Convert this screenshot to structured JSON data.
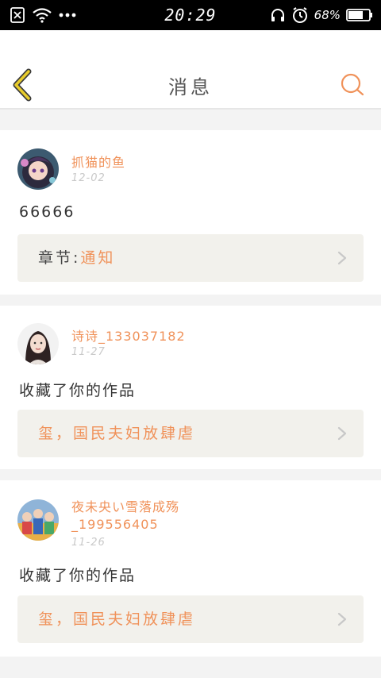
{
  "status_bar": {
    "time": "20:29",
    "battery": "68%"
  },
  "header": {
    "title": "消息"
  },
  "messages": [
    {
      "user_name": "抓猫的鱼",
      "date": "12-02",
      "text": "66666",
      "link_prefix": "章节:",
      "link_title": "通知"
    },
    {
      "user_name": "诗诗_133037182",
      "date": "11-27",
      "text": "收藏了你的作品",
      "link_prefix": "",
      "link_title": "玺，国民夫妇放肆虐"
    },
    {
      "user_name": "夜未央い雪落成殇_199556405",
      "date": "11-26",
      "text": "收藏了你的作品",
      "link_prefix": "",
      "link_title": "玺，国民夫妇放肆虐"
    }
  ],
  "colors": {
    "accent": "#f0925a",
    "back_icon": "#e8cc2c",
    "link_bg": "#f2f1ec"
  }
}
